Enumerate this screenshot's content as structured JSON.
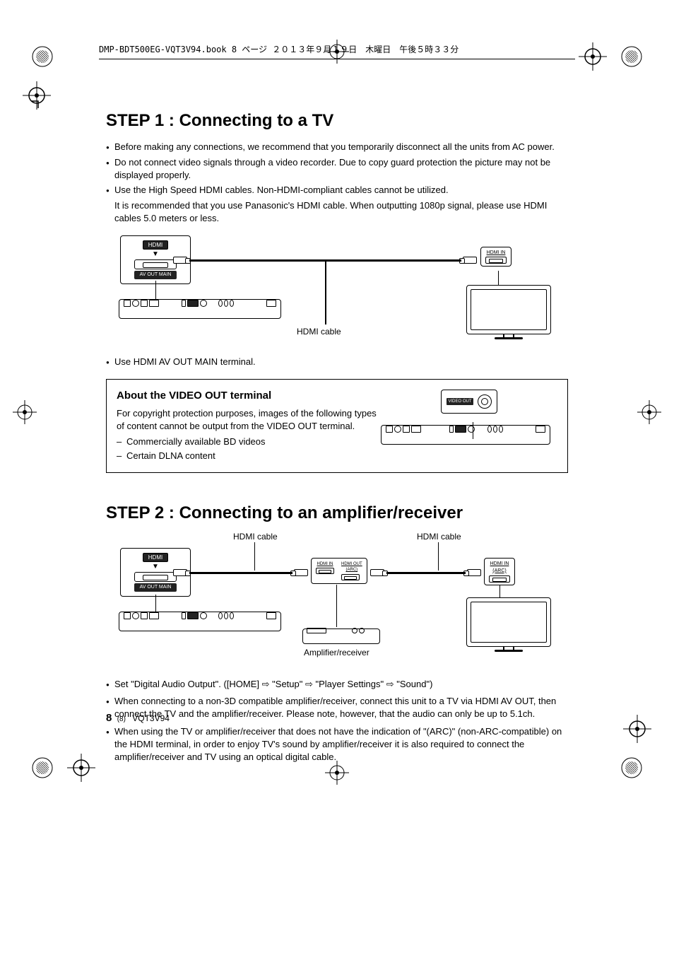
{
  "print_header": "DMP-BDT500EG-VQT3V94.book  8 ページ  ２０１３年９月１９日　木曜日　午後５時３３分",
  "step1": {
    "title": "STEP 1 :  Connecting to a TV",
    "bullets": [
      "Before making any connections, we recommend that you temporarily disconnect all the units from AC power.",
      "Do not connect video signals through a video recorder. Due to copy guard protection the picture may not be displayed properly.",
      "Use the High Speed HDMI cables. Non-HDMI-compliant cables cannot be utilized."
    ],
    "bullet3_sub": "It is recommended that you use Panasonic's HDMI cable. When outputting 1080p signal, please use HDMI cables 5.0 meters or less.",
    "diagram": {
      "unit_port_top": "HDMI",
      "unit_port_bottom": "AV OUT   MAIN",
      "tv_port": "HDMI IN",
      "cable_caption": "HDMI cable"
    },
    "after_diagram_bullet": "Use HDMI AV OUT MAIN terminal."
  },
  "infobox": {
    "heading": "About the VIDEO OUT terminal",
    "intro": "For copyright protection purposes, images of the following types of content cannot be output from the VIDEO OUT terminal.",
    "items": [
      "Commercially available BD videos",
      "Certain DLNA content"
    ],
    "vout_label": "VIDEO OUT"
  },
  "step2": {
    "title": "STEP 2 :  Connecting to an amplifier/receiver",
    "diagram": {
      "hdmi_cable_left": "HDMI cable",
      "hdmi_cable_right": "HDMI cable",
      "unit_port_top": "HDMI",
      "unit_port_bottom": "AV OUT   MAIN",
      "amp_in": "HDMI IN",
      "amp_out": "HDMI OUT\n(ARC)",
      "tv_port": "HDMI IN\n(ARC)",
      "amp_caption": "Amplifier/receiver"
    },
    "bullets": [
      "Set \"Digital Audio Output\". ([HOME] ⇨ \"Setup\" ⇨ \"Player Settings\" ⇨ \"Sound\")",
      "When connecting to a non-3D compatible amplifier/receiver, connect this unit to a TV via HDMI AV OUT, then connect the TV and the amplifier/receiver. Please note, however, that the audio can only be up to 5.1ch.",
      "When using the TV or amplifier/receiver that does not have the indication of \"(ARC)\" (non-ARC-compatible) on the HDMI terminal, in order to enjoy TV's sound by amplifier/receiver it is also required to connect the amplifier/receiver and TV using an optical digital cable."
    ]
  },
  "footer": {
    "page": "8",
    "paren": "(8)",
    "doc": "VQT3V94"
  }
}
